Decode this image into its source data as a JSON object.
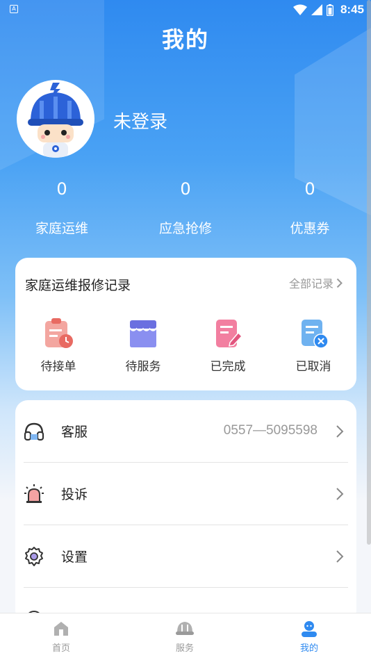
{
  "status_bar": {
    "time": "8:45",
    "notification_badge": "A"
  },
  "page": {
    "title": "我的"
  },
  "profile": {
    "login_text": "未登录"
  },
  "stats": [
    {
      "value": "0",
      "label": "家庭运维"
    },
    {
      "value": "0",
      "label": "应急抢修"
    },
    {
      "value": "0",
      "label": "优惠券"
    }
  ],
  "records": {
    "title": "家庭运维报修记录",
    "all_link": "全部记录",
    "items": [
      {
        "label": "待接单",
        "icon": "clipboard-clock-icon"
      },
      {
        "label": "待服务",
        "icon": "store-icon"
      },
      {
        "label": "已完成",
        "icon": "document-edit-icon"
      },
      {
        "label": "已取消",
        "icon": "document-cancel-icon"
      }
    ]
  },
  "menu": [
    {
      "label": "客服",
      "value": "0557—5095598",
      "icon": "headset-icon"
    },
    {
      "label": "投诉",
      "icon": "alarm-icon"
    },
    {
      "label": "设置",
      "icon": "gear-icon"
    }
  ],
  "tabs": [
    {
      "label": "首页",
      "icon": "home-icon",
      "active": false
    },
    {
      "label": "服务",
      "icon": "helmet-icon",
      "active": false
    },
    {
      "label": "我的",
      "icon": "user-icon",
      "active": true
    }
  ],
  "colors": {
    "primary": "#2f8af0",
    "inactive": "#999999"
  }
}
